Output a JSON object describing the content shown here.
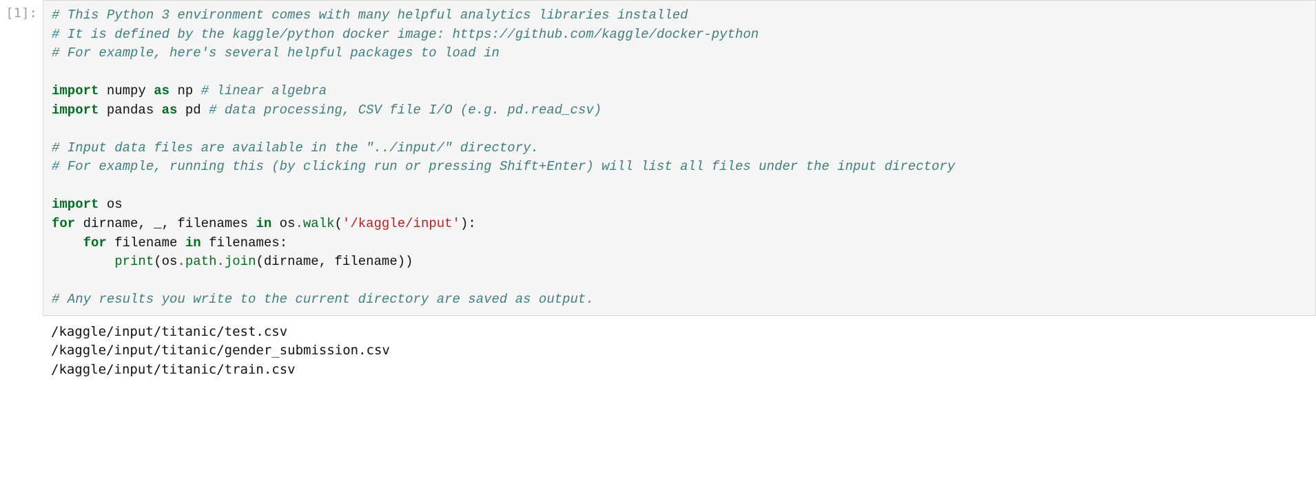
{
  "cell": {
    "prompt": "[1]:",
    "code": {
      "tokens": [
        {
          "cls": "c",
          "t": "# This Python 3 environment comes with many helpful analytics libraries installed"
        },
        {
          "cls": "",
          "t": "\n"
        },
        {
          "cls": "c",
          "t": "# It is defined by the kaggle/python docker image: https://github.com/kaggle/docker-python"
        },
        {
          "cls": "",
          "t": "\n"
        },
        {
          "cls": "c",
          "t": "# For example, here's several helpful packages to load in"
        },
        {
          "cls": "",
          "t": "\n\n"
        },
        {
          "cls": "kw",
          "t": "import"
        },
        {
          "cls": "",
          "t": " numpy "
        },
        {
          "cls": "kw",
          "t": "as"
        },
        {
          "cls": "",
          "t": " np "
        },
        {
          "cls": "c",
          "t": "# linear algebra"
        },
        {
          "cls": "",
          "t": "\n"
        },
        {
          "cls": "kw",
          "t": "import"
        },
        {
          "cls": "",
          "t": " pandas "
        },
        {
          "cls": "kw",
          "t": "as"
        },
        {
          "cls": "",
          "t": " pd "
        },
        {
          "cls": "c",
          "t": "# data processing, CSV file I/O (e.g. pd.read_csv)"
        },
        {
          "cls": "",
          "t": "\n\n"
        },
        {
          "cls": "c",
          "t": "# Input data files are available in the \"../input/\" directory."
        },
        {
          "cls": "",
          "t": "\n"
        },
        {
          "cls": "c",
          "t": "# For example, running this (by clicking run or pressing Shift+Enter) will list all files under the input directory"
        },
        {
          "cls": "",
          "t": "\n\n"
        },
        {
          "cls": "kw",
          "t": "import"
        },
        {
          "cls": "",
          "t": " os\n"
        },
        {
          "cls": "kw",
          "t": "for"
        },
        {
          "cls": "",
          "t": " dirname, _, filenames "
        },
        {
          "cls": "kw",
          "t": "in"
        },
        {
          "cls": "",
          "t": " os"
        },
        {
          "cls": "op",
          "t": "."
        },
        {
          "cls": "fn",
          "t": "walk"
        },
        {
          "cls": "",
          "t": "("
        },
        {
          "cls": "st",
          "t": "'/kaggle/input'"
        },
        {
          "cls": "",
          "t": "):\n"
        },
        {
          "cls": "",
          "t": "    "
        },
        {
          "cls": "kw",
          "t": "for"
        },
        {
          "cls": "",
          "t": " filename "
        },
        {
          "cls": "kw",
          "t": "in"
        },
        {
          "cls": "",
          "t": " filenames:\n"
        },
        {
          "cls": "",
          "t": "        "
        },
        {
          "cls": "bn",
          "t": "print"
        },
        {
          "cls": "",
          "t": "(os"
        },
        {
          "cls": "op",
          "t": "."
        },
        {
          "cls": "fn",
          "t": "path"
        },
        {
          "cls": "op",
          "t": "."
        },
        {
          "cls": "fn",
          "t": "join"
        },
        {
          "cls": "",
          "t": "(dirname, filename))\n\n"
        },
        {
          "cls": "c",
          "t": "# Any results you write to the current directory are saved as output."
        }
      ]
    },
    "output_lines": [
      "/kaggle/input/titanic/test.csv",
      "/kaggle/input/titanic/gender_submission.csv",
      "/kaggle/input/titanic/train.csv"
    ]
  }
}
